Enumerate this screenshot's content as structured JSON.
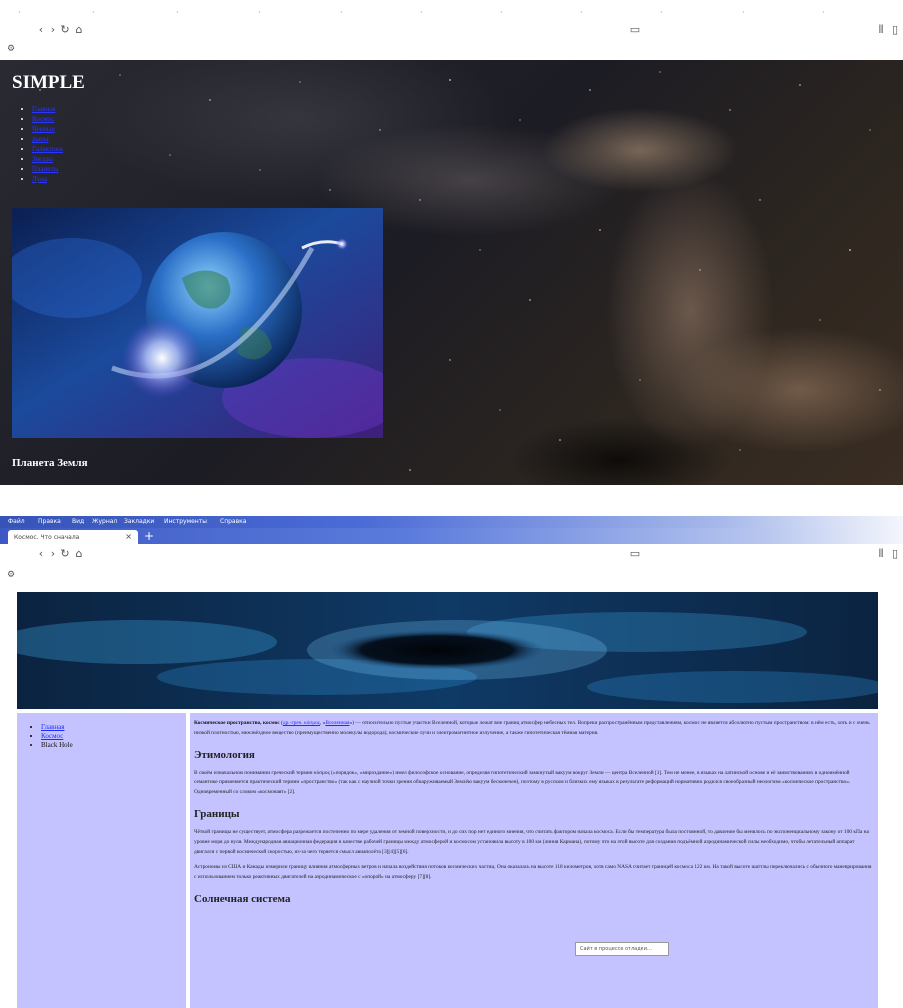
{
  "screenshot_1": {
    "toolbar": {
      "back_icon": "back-arrow-icon",
      "forward_icon": "forward-arrow-icon",
      "reload_icon": "reload-icon",
      "home_icon": "home-icon"
    },
    "page": {
      "site_title": "SIMPLE",
      "menu_items": [
        "Главная",
        "Космос",
        "Черные",
        "дыры",
        "Галактики",
        "Звезды",
        "Планеты",
        "Луна"
      ],
      "caption": "Планета Земля"
    }
  },
  "screenshot_2": {
    "menubar": [
      "Файл",
      "Правка",
      "Вид",
      "Журнал",
      "Закладки",
      "Инструменты",
      "Справка"
    ],
    "tab": {
      "title": "Космос. Что сначала",
      "close_icon": "close-icon",
      "new_tab_icon": "plus-icon"
    },
    "sidebar": {
      "items": [
        {
          "label": "Главная",
          "link": true
        },
        {
          "label": "Космос",
          "link": true
        },
        {
          "label": "Black Hole",
          "link": false
        }
      ]
    },
    "main": {
      "intro_term": "Космическое пространство, космос",
      "intro_links": [
        "др.-греч. κόσμος",
        "Вселенная",
        "Вселенной",
        "атмосфер",
        "небесных тел"
      ],
      "intro_rest": "— относительно пустые участки Вселенной, которые лежат вне границ атмосфер небесных тел. Вопреки распространённым представлениям, космос не является абсолютно пустым пространством: в нём есть, хоть и с очень низкой плотностью, межзвёздное вещество (преимущественно молекулы водорода), космические лучи и электромагнитное излучение, а также гипотетическая тёмная материя.",
      "sections": [
        {
          "heading": "Этимология",
          "text": "В своём изначальном понимании греческий термин κόσμος («порядок», «мироздание») имел философское основание, определяя гипотетический замкнутый вакуум вокруг Земли — центра Вселенной [1]. Тем не менее, в языках на латинской основе и её заимствованиях в одноимённой семантике применяется практический термин «пространство» (так как с научной точки зрения обнаруживаемый Землёю вакуум бесконечен), поэтому в русском и близких ему языках в результате реформаций нормативно родился своеобразный неологизм «космическое пространство». Одновременный со словом «космонавт» [2]."
        },
        {
          "heading": "Границы",
          "text": "Чёткой границы не существует, атмосфера разрежается постепенно по мере удаления от земной поверхности, и до сих пор нет единого мнения, что считать фактором начала космоса. Если бы температура была постоянной, то давление бы менялось по экспоненциальному закону от 100 кПа на уровне моря до нуля. Международная авиационная федерация в качестве рабочей границы между атмосферой и космосом установила высоту в 100 км (линия Кармана), потому что на этой высоте для создания подъёмной аэродинамической силы необходимо, чтобы летательный аппарат двигался с первой космической скоростью, из-за чего теряется смысл авиаполёта [3][4][5][6].",
          "text2": "Астрономы из США и Канады измерили границу влияния атмосферных ветров и начала воздействия потоков космических частиц. Она оказалась на высоте 118 километров, хотя само NASA считает границей космоса 122 км. На такой высоте шаттлы переключались с обычного маневрирования с использованием только реактивных двигателей на аэродинамическое с «опорой» на атмосферу [7][8]."
        },
        {
          "heading": "Солнечная система",
          "text": ""
        }
      ]
    },
    "tooltip": "Сайт в процессе отладки…"
  }
}
